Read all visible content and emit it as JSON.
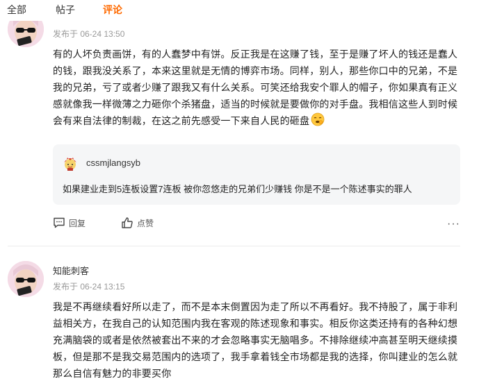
{
  "tabs": [
    {
      "label": "全部"
    },
    {
      "label": "帖子"
    },
    {
      "label": "评论"
    }
  ],
  "accent_color": "#ff6a00",
  "comments": [
    {
      "username": "",
      "meta": "发布于 06-24 13:50",
      "text": "有的人坏负责画饼，有的人蠢梦中有饼。反正我是在这赚了钱，至于是赚了坏人的钱还是蠢人的钱，跟我没关系了，本来这里就是无情的博弈市场。同样，别人，那些你口中的兄弟，不是我的兄弟，亏了或者少赚了跟我又有什么关系。可笑还给我安个罪人的帽子，你如果真有正义感就像我一样微薄之力砸你个杀猪盘，适当的时候就是要做你的对手盘。我相信这些人到时候会有来自法律的制裁，在这之前先感受一下来自人民的砸盘",
      "emoji": "smirk-emoji",
      "quote": {
        "username": "cssmjlangsyb",
        "text": "如果建业走到5连板设置7连板 被你忽悠走的兄弟们少赚钱 你是不是一个陈述事实的罪人"
      },
      "actions": {
        "reply": "回复",
        "like": "点赞",
        "more": "···"
      }
    },
    {
      "username": "知能刺客",
      "meta": "发布于 06-24 13:15",
      "text": "我是不再继续看好所以走了，而不是本末倒置因为走了所以不再看好。我不持股了，属于非利益相关方，在我自己的认知范围内我在客观的陈述现象和事实。相反你这类还持有的各种幻想充满脑袋的或者是依然被套出不来的才会忽略事实无脑唱多。不排除继续冲高甚至明天继续摸板，但是那不是我交易范围内的选项了，我手拿着钱全市场都是我的选择，你叫建业的怎么就那么自信有魅力的非要买你"
    }
  ]
}
